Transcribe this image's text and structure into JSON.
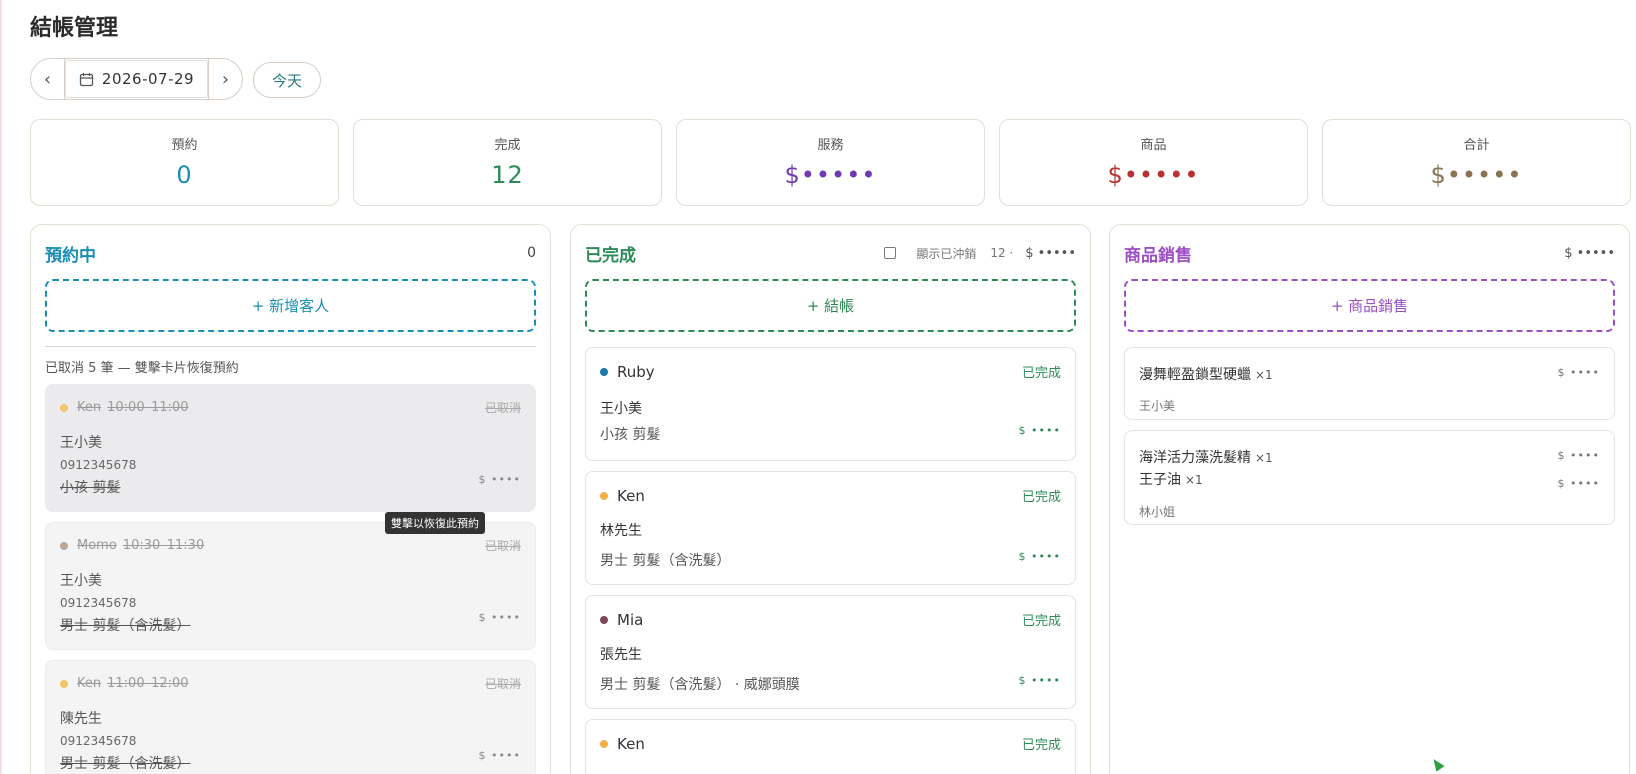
{
  "page": {
    "title": "結帳管理"
  },
  "date_nav": {
    "prev": "‹",
    "date": "2026-07-29",
    "next": "›",
    "today": "今天"
  },
  "stats": [
    {
      "label": "預約",
      "value": "0",
      "color": "#1a8fb5"
    },
    {
      "label": "完成",
      "value": "12",
      "color": "#2e8b57"
    },
    {
      "label": "服務",
      "value": "$•••••",
      "color": "#6f3bb4"
    },
    {
      "label": "商品",
      "value": "$•••••",
      "color": "#b83232"
    },
    {
      "label": "合計",
      "value": "$•••••",
      "color": "#8a7355"
    }
  ],
  "col_reserved": {
    "title": "預約中",
    "count": "0",
    "add": "+ 新增客人",
    "color": "#1a8fb5",
    "cancel_note": "已取消 5 筆 — 雙擊卡片恢復預約",
    "tooltip": "雙擊以恢復此預約",
    "cards": [
      {
        "stylist": "Ken",
        "time": "10:00–11:00",
        "status": "已取消",
        "customer": "王小美",
        "phone": "0912345678",
        "service": "小孩 剪髮",
        "price": "$ ••••",
        "dot": "#f2c46a"
      },
      {
        "stylist": "Momo",
        "time": "10:30–11:30",
        "status": "已取消",
        "customer": "王小美",
        "phone": "0912345678",
        "service": "男士 剪髮（含洗髮）",
        "price": "$ ••••",
        "dot": "#b9a89a"
      },
      {
        "stylist": "Ken",
        "time": "11:00–12:00",
        "status": "已取消",
        "customer": "陳先生",
        "phone": "0912345678",
        "service": "男士 剪髮（含洗髮）",
        "price": "$ ••••",
        "dot": "#f2c46a"
      }
    ]
  },
  "col_done": {
    "title": "已完成",
    "show_void": "顯示已沖銷",
    "count": "12 ·",
    "total": "$ •••••",
    "add": "+ 結帳",
    "color": "#2e8b57",
    "cards": [
      {
        "stylist": "Ruby",
        "status": "已完成",
        "customer": "王小美",
        "service": "小孩 剪髮",
        "price": "$ ••••",
        "dot": "#1a78a8"
      },
      {
        "stylist": "Ken",
        "status": "已完成",
        "customer": "林先生",
        "service": "男士 剪髮（含洗髮）",
        "price": "$ ••••",
        "dot": "#f0b04a"
      },
      {
        "stylist": "Mia",
        "status": "已完成",
        "customer": "張先生",
        "service": "男士 剪髮（含洗髮） · 威娜頭膜",
        "price": "$ ••••",
        "dot": "#7a4a5a"
      },
      {
        "stylist": "Ken",
        "status": "已完成",
        "dot": "#f0b04a"
      }
    ]
  },
  "col_products": {
    "title": "商品銷售",
    "total": "$ •••••",
    "add": "+ 商品銷售",
    "color": "#9b4fc4",
    "cards": [
      {
        "items": [
          {
            "name": "漫舞輕盈鎖型硬蠟",
            "qty": "×1",
            "price": "$ ••••"
          }
        ],
        "buyer": "王小美"
      },
      {
        "items": [
          {
            "name": "海洋活力藻洗髮精",
            "qty": "×1",
            "price": "$ ••••"
          },
          {
            "name": "王子油",
            "qty": "×1",
            "price": "$ ••••"
          }
        ],
        "buyer": "林小姐"
      }
    ]
  }
}
